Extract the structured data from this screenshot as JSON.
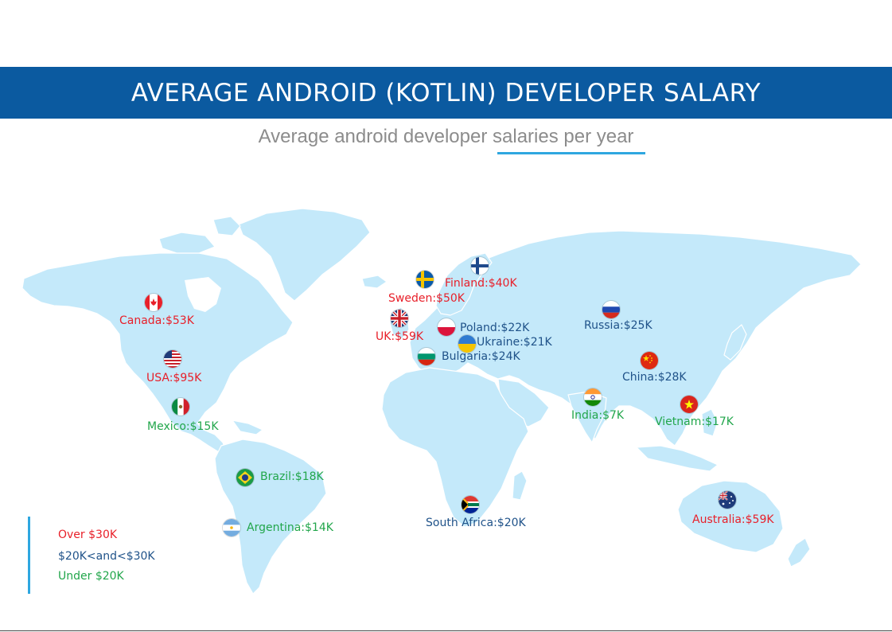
{
  "header": {
    "title": "AVERAGE ANDROID (KOTLIN) DEVELOPER  SALARY",
    "subtitle": "Average android developer salaries per year"
  },
  "colors": {
    "banner": "#0b5aa0",
    "land": "#c4e9fa",
    "over_30k": "#e8202a",
    "between_20k_30k": "#1f5289",
    "under_20k": "#22a64b",
    "accent": "#2ea7e0"
  },
  "countries": [
    {
      "id": "canada",
      "label": "Canada:$53K",
      "tier": "over_30k"
    },
    {
      "id": "usa",
      "label": "USA:$95K",
      "tier": "over_30k"
    },
    {
      "id": "mexico",
      "label": "Mexico:$15K",
      "tier": "under_20k"
    },
    {
      "id": "brazil",
      "label": "Brazil:$18K",
      "tier": "under_20k"
    },
    {
      "id": "argentina",
      "label": "Argentina:$14K",
      "tier": "under_20k"
    },
    {
      "id": "sweden",
      "label": "Sweden:$50K",
      "tier": "over_30k"
    },
    {
      "id": "finland",
      "label": "Finland:$40K",
      "tier": "over_30k"
    },
    {
      "id": "uk",
      "label": "UK:$59K",
      "tier": "over_30k"
    },
    {
      "id": "poland",
      "label": "Poland:$22K",
      "tier": "between_20k_30k"
    },
    {
      "id": "ukraine",
      "label": "Ukraine:$21K",
      "tier": "between_20k_30k"
    },
    {
      "id": "bulgaria",
      "label": "Bulgaria:$24K",
      "tier": "between_20k_30k"
    },
    {
      "id": "russia",
      "label": "Russia:$25K",
      "tier": "between_20k_30k"
    },
    {
      "id": "china",
      "label": "China:$28K",
      "tier": "between_20k_30k"
    },
    {
      "id": "india",
      "label": "India:$7K",
      "tier": "under_20k"
    },
    {
      "id": "vietnam",
      "label": "Vietnam:$17K",
      "tier": "under_20k"
    },
    {
      "id": "south_africa",
      "label": "South Africa:$20K",
      "tier": "between_20k_30k"
    },
    {
      "id": "australia",
      "label": "Australia:$59K",
      "tier": "over_30k"
    }
  ],
  "legend": [
    {
      "label": "Over $30K",
      "tier": "over_30k"
    },
    {
      "label": "$20K<and<$30K",
      "tier": "between_20k_30k"
    },
    {
      "label": "Under $20K",
      "tier": "under_20k"
    }
  ]
}
